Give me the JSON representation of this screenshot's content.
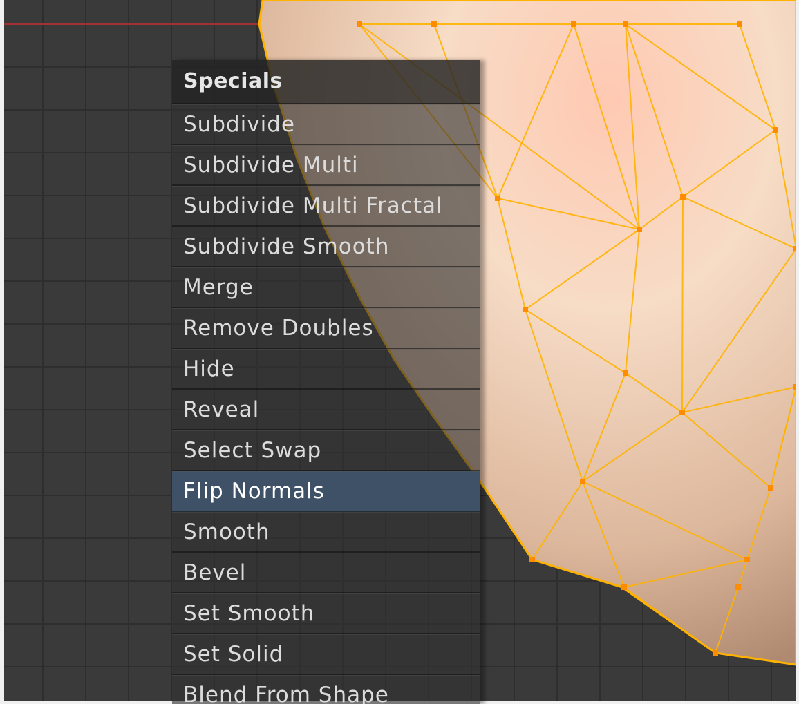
{
  "menu": {
    "title": "Specials",
    "items": [
      {
        "label": "Subdivide"
      },
      {
        "label": "Subdivide Multi"
      },
      {
        "label": "Subdivide Multi Fractal"
      },
      {
        "label": "Subdivide Smooth"
      },
      {
        "label": "Merge"
      },
      {
        "label": "Remove Doubles"
      },
      {
        "label": "Hide"
      },
      {
        "label": "Reveal"
      },
      {
        "label": "Select Swap"
      },
      {
        "label": "Flip Normals",
        "active": true
      },
      {
        "label": "Smooth"
      },
      {
        "label": "Bevel"
      },
      {
        "label": "Set Smooth"
      },
      {
        "label": "Set Solid"
      },
      {
        "label": "Blend From Shape"
      }
    ]
  },
  "colors": {
    "viewport_bg": "#3a3a3a",
    "grid_line": "#2e2e2e",
    "axis_x": "#a03232",
    "mesh_edge": "#ffb300",
    "mesh_vertex": "#ff8c00",
    "mesh_face": "#f5d3b9",
    "menu_highlight": "#3e5166"
  }
}
